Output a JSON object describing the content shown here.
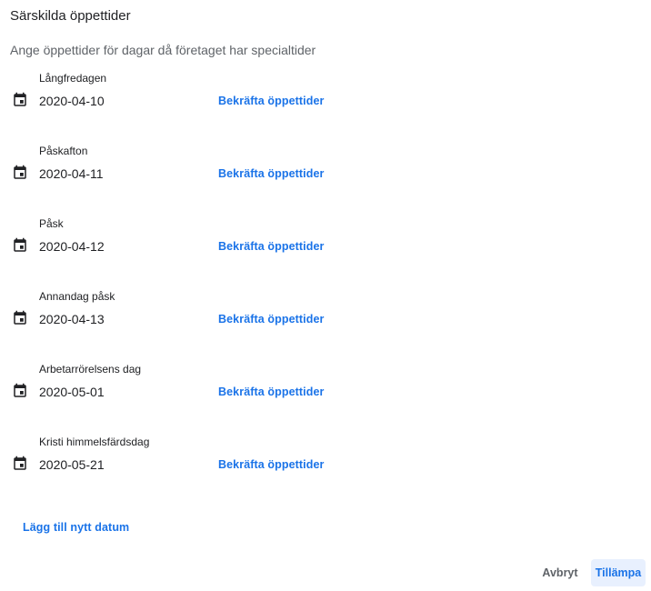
{
  "dialog": {
    "title": "Särskilda öppettider",
    "subtitle": "Ange öppettider för dagar då företaget har specialtider"
  },
  "special_days": [
    {
      "label": "Långfredagen",
      "date": "2020-04-10",
      "action": "Bekräfta öppettider",
      "icon": "calendar-icon"
    },
    {
      "label": "Påskafton",
      "date": "2020-04-11",
      "action": "Bekräfta öppettider",
      "icon": "calendar-icon"
    },
    {
      "label": "Påsk",
      "date": "2020-04-12",
      "action": "Bekräfta öppettider",
      "icon": "calendar-icon"
    },
    {
      "label": "Annandag påsk",
      "date": "2020-04-13",
      "action": "Bekräfta öppettider",
      "icon": "calendar-icon"
    },
    {
      "label": "Arbetarrörelsens dag",
      "date": "2020-05-01",
      "action": "Bekräfta öppettider",
      "icon": "calendar-icon"
    },
    {
      "label": "Kristi himmelsfärdsdag",
      "date": "2020-05-21",
      "action": "Bekräfta öppettider",
      "icon": "calendar-icon"
    }
  ],
  "add_date_label": "Lägg till nytt datum",
  "footer": {
    "cancel_label": "Avbryt",
    "apply_label": "Tillämpa"
  },
  "colors": {
    "accent": "#1a73e8",
    "apply_bg": "#e8f0fe",
    "text_primary": "#202124",
    "text_secondary": "#5f6368"
  }
}
